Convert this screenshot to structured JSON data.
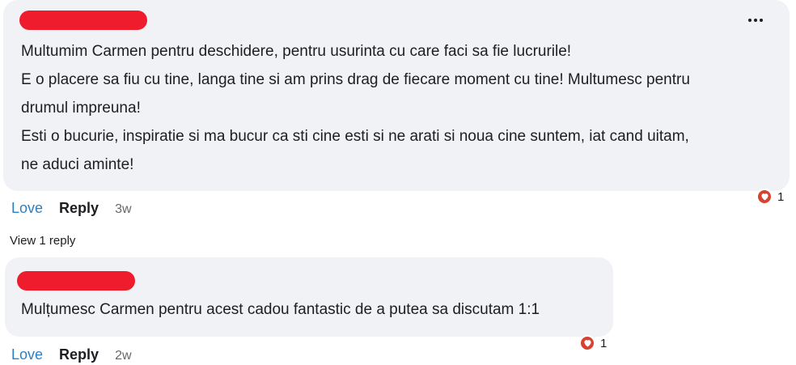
{
  "comments": [
    {
      "author": "",
      "lines": [
        "Multumim Carmen pentru deschidere, pentru usurinta cu care faci sa fie lucrurile!",
        "E o placere sa fiu cu tine, langa tine si am prins drag de fiecare moment cu tine! Multumesc pentru",
        "drumul impreuna!",
        "Esti o bucurie, inspiratie si ma bucur ca sti cine esti si ne arati si noua cine suntem, iat cand uitam,",
        "ne aduci aminte!"
      ],
      "love_label": "Love",
      "reply_label": "Reply",
      "time": "3w",
      "reaction_count": "1",
      "reaction_icon": "heart-icon",
      "more_icon": "more-options-icon"
    },
    {
      "author": "",
      "lines": [
        "Mulțumesc Carmen pentru acest cadou fantastic de a putea sa discutam 1:1"
      ],
      "love_label": "Love",
      "reply_label": "Reply",
      "time": "2w",
      "reaction_count": "1",
      "reaction_icon": "heart-icon"
    }
  ],
  "view_replies_label": "View 1 reply",
  "colors": {
    "bubble_bg": "#f0f2f5",
    "redaction": "#ee1c2c",
    "love_link": "#2f7fc0",
    "reaction_heart": "#d8412f",
    "muted_text": "#65676b"
  }
}
